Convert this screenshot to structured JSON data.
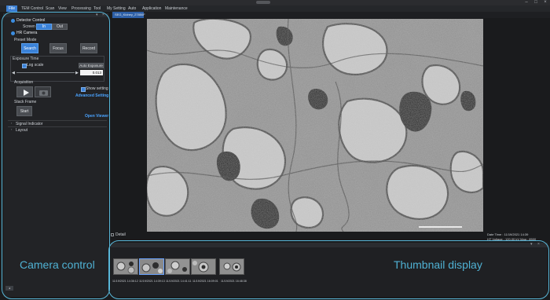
{
  "menu": {
    "items": [
      {
        "label": "File",
        "active": true
      },
      {
        "label": "TEM Control"
      },
      {
        "label": "Scan"
      },
      {
        "label": "View"
      },
      {
        "label": "Processing"
      },
      {
        "label": "Tool"
      },
      {
        "label": "My Setting"
      },
      {
        "label": "Auto"
      },
      {
        "label": "Application"
      },
      {
        "label": "Maintenance"
      }
    ]
  },
  "left_panel": {
    "detector_control": "Detector Control",
    "screen_label": "Screen",
    "screen_in": "In",
    "screen_out": "Out",
    "hr_camera": "HR Camera",
    "preset_mode": "Preset Mode",
    "preset_search": "Search",
    "preset_focus": "Focus",
    "preset_record": "Record",
    "exposure_time": "Exposure Time",
    "log_scale": "Log scale",
    "auto_exposure": "Auto Exposure",
    "exposure_value": "0.013",
    "acquisition": "Acquisition",
    "show_setting": "Show setting",
    "advanced_setting": "Advanced Setting",
    "stack_frame": "Stack Frame",
    "start": "Start",
    "open_viewer": "Open Viewer",
    "signal_indicator": "Signal Indicator",
    "layout": "Layout"
  },
  "viewer": {
    "tab_label": "SEG_Kidney_27850F",
    "detail_label": "Detail",
    "date_time": "Date Time : 11/19/2021 14:39",
    "ht_mag": "HT Voltage : 120.00 kV  Mag : 8500"
  },
  "thumbnails": {
    "items": [
      {
        "label": "11/19/2021 14:36:12"
      },
      {
        "label": "11/19/2021 14:39:13"
      },
      {
        "label": "11/19/2021 14:41:11"
      },
      {
        "label": "11/19/2021 16:09:01"
      },
      {
        "label": "11/19/2021 16:48:38"
      }
    ]
  },
  "annotations": {
    "camera_control": "Camera control",
    "thumbnail_display": "Thumbnail display"
  },
  "colors": {
    "accent": "#3b82d8",
    "annotation": "#59b7d9"
  }
}
